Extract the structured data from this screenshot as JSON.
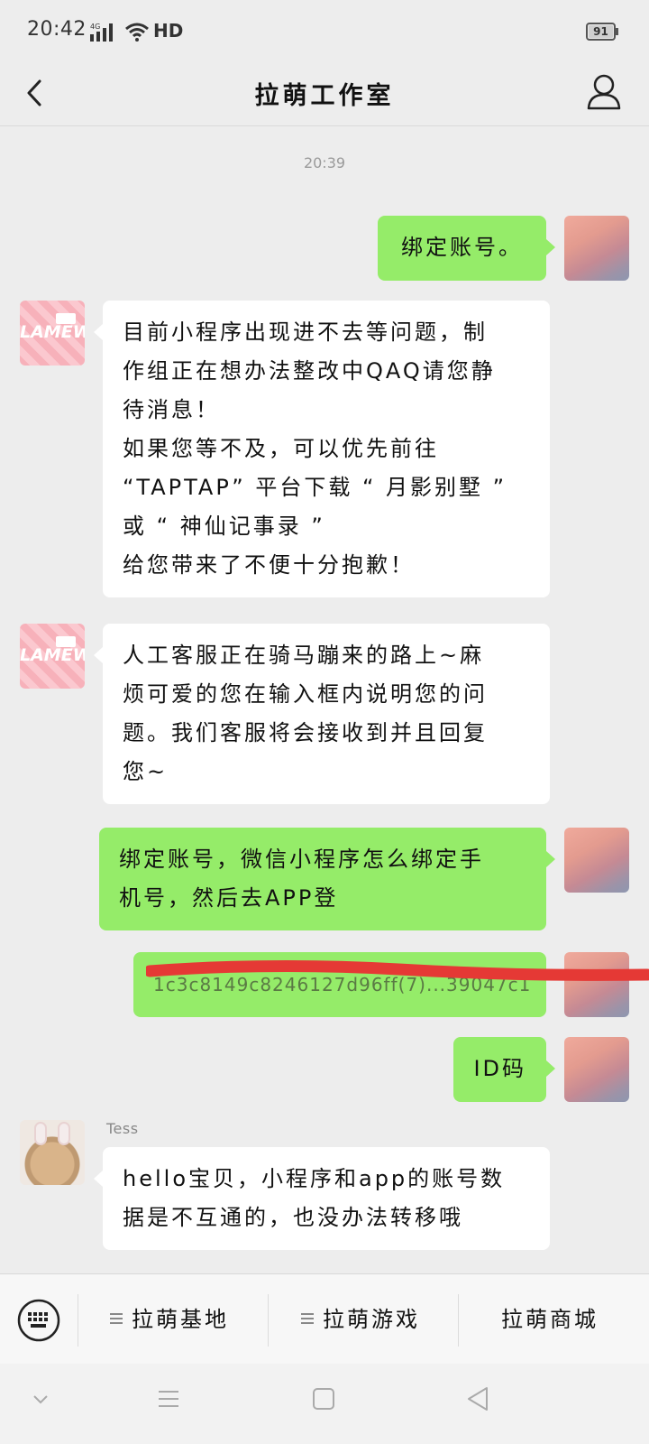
{
  "status_bar": {
    "time": "20:42",
    "network": "4G",
    "hd": "HD",
    "battery": "91"
  },
  "nav": {
    "title": "拉萌工作室",
    "back_icon": "back-chevron-icon",
    "profile_icon": "person-icon"
  },
  "chat": {
    "timestamp": "20:39",
    "messages": [
      {
        "from": "me",
        "text": "绑定账号。"
      },
      {
        "from": "official",
        "text": "目前小程序出现进不去等问题，制\n作组正在想办法整改中QAQ请您静\n待消息！\n如果您等不及，可以优先前往\n“TAPTAP” 平台下载 “ 月影别墅 ”\n或 “ 神仙记事录 ”\n给您带来了不便十分抱歉！"
      },
      {
        "from": "official",
        "text": "人工客服正在骑马蹦来的路上~麻\n烦可爱的您在输入框内说明您的问\n题。我们客服将会接收到并且回复\n您~"
      },
      {
        "from": "me",
        "text": "绑定账号，微信小程序怎么绑定手\n机号，然后去APP登"
      },
      {
        "from": "me",
        "text": "1c3c8149c8246127d96ff(7)...39047c1",
        "redacted": true
      },
      {
        "from": "me",
        "text": "ID码"
      },
      {
        "from": "agent",
        "sender": "Tess",
        "text": "hello宝贝，小程序和app的账号数\n据是不互通的，也没办法转移哦"
      }
    ]
  },
  "menu": {
    "items": [
      {
        "label": "拉萌基地",
        "has_submenu": true
      },
      {
        "label": "拉萌游戏",
        "has_submenu": true
      },
      {
        "label": "拉萌商城",
        "has_submenu": false
      }
    ],
    "keyboard_icon": "keyboard-icon"
  },
  "system_nav": {
    "icons": [
      "chevron-down-icon",
      "menu-lines-icon",
      "home-square-icon",
      "back-triangle-icon"
    ]
  },
  "colors": {
    "my_bubble": "#95ec69",
    "their_bubble": "#ffffff",
    "chat_bg": "#ededed",
    "redaction": "#e53935"
  }
}
